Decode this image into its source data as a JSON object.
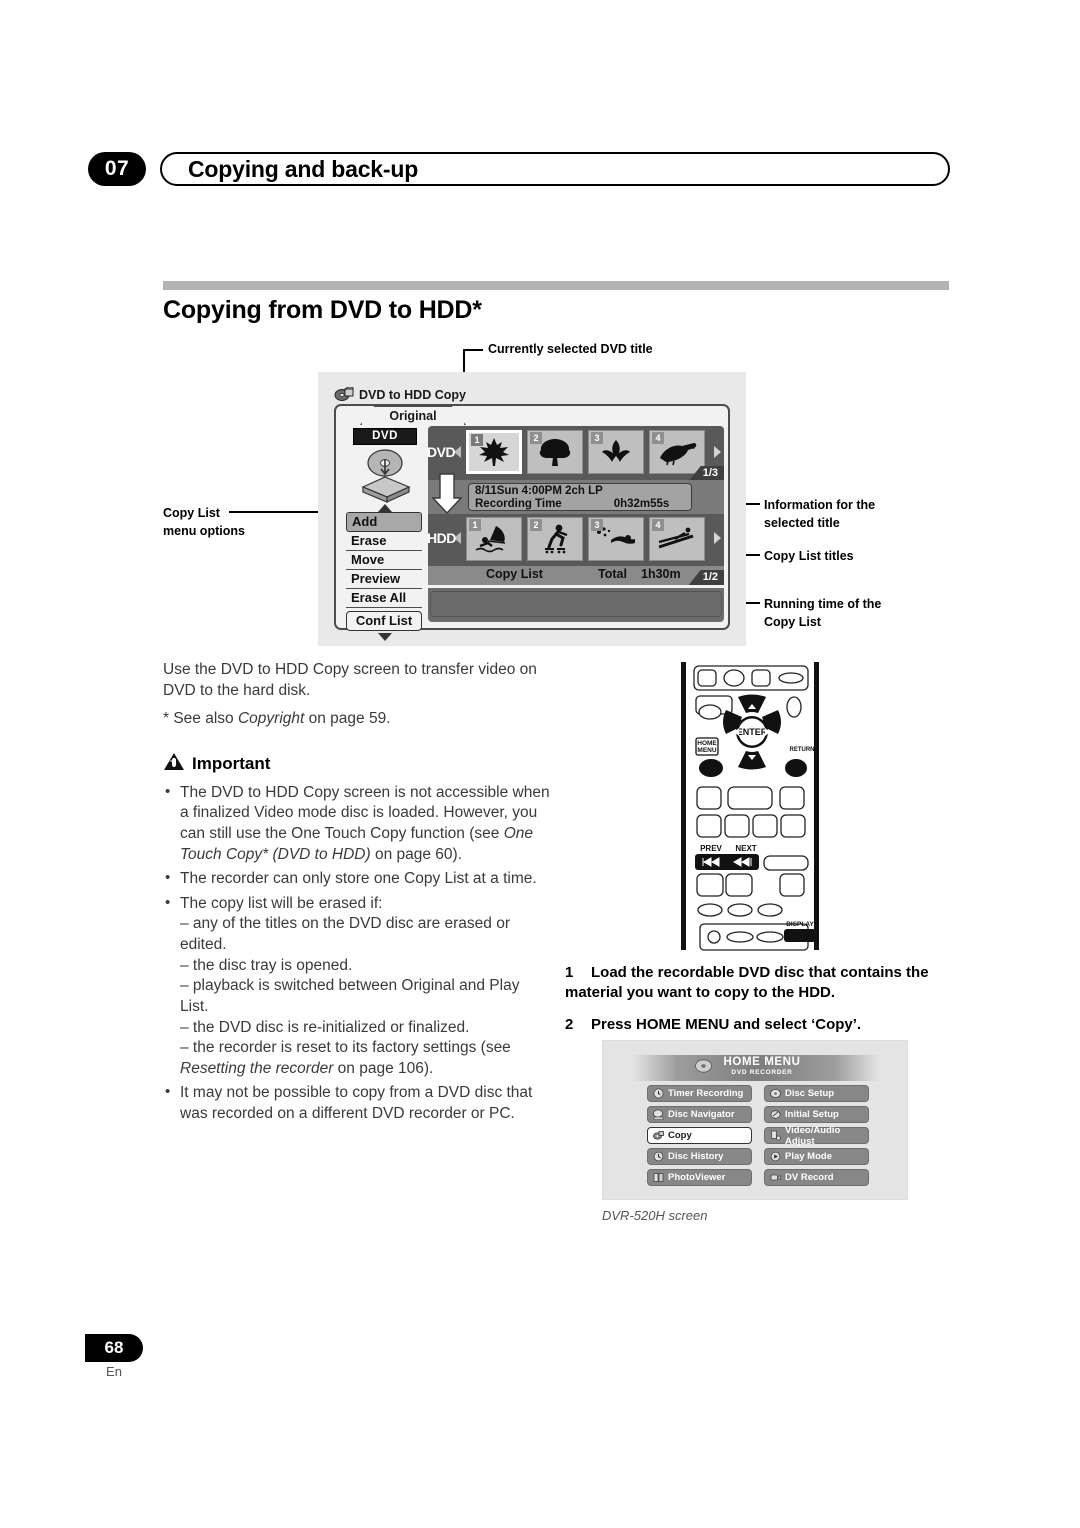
{
  "header": {
    "chapter_number": "07",
    "chapter_title": "Copying and back-up"
  },
  "section": {
    "title": "Copying from DVD to HDD*"
  },
  "figure": {
    "callouts": {
      "top": "Currently selected DVD title",
      "left_line1": "Copy List",
      "left_line2": "menu options",
      "right_1_line1": "Information for the",
      "right_1_line2": "selected title",
      "right_2": "Copy List titles",
      "right_3_line1": "Running time of the",
      "right_3_line2": "Copy List"
    },
    "screen": {
      "title": "DVD to HDD Copy",
      "tab": "Original",
      "source_badge": "DVD",
      "menu_options": [
        "Add",
        "Erase",
        "Move",
        "Preview",
        "Erase All"
      ],
      "selected_option": "Add",
      "conf_list_button": "Conf List",
      "dvd_row": {
        "label": "DVD",
        "thumbnails": [
          "1",
          "2",
          "3",
          "4"
        ],
        "selected": "1",
        "page": "1/3"
      },
      "info": {
        "line1": "8/11Sun  4:00PM   2ch  LP",
        "label": "Recording Time",
        "value": "0h32m55s"
      },
      "hdd_row": {
        "label": "HDD",
        "thumbnails": [
          "1",
          "2",
          "3",
          "4"
        ],
        "page": "1/2"
      },
      "copy_list_bar": {
        "label": "Copy List",
        "total_label": "Total",
        "total_value": "1h30m"
      }
    }
  },
  "body": {
    "intro": "Use the DVD to HDD Copy screen to transfer video on DVD to the hard disk.",
    "footnote_pre": "* See also ",
    "footnote_em": "Copyright",
    "footnote_post": " on page 59.",
    "important_label": "Important",
    "bullets": [
      {
        "pre": "The DVD to HDD Copy screen is not accessible when a finalized Video mode disc is loaded. However, you can still use the One Touch Copy function (see ",
        "em": "One Touch Copy* (DVD to HDD)",
        "post": " on page 60)."
      },
      {
        "pre": "The recorder can only store one Copy List at a time.",
        "em": "",
        "post": ""
      },
      {
        "pre": "The copy list will be erased if:",
        "dashes": [
          "– any of the titles on the DVD disc are erased or edited.",
          "– the disc tray is opened.",
          "– playback is switched between Original and Play List.",
          "– the DVD disc is re-initialized or finalized."
        ],
        "last_dash_pre": "– the recorder is reset to its factory settings (see ",
        "last_dash_em": "Resetting the recorder",
        "last_dash_post": " on page 106)."
      },
      {
        "pre": "It may not be possible to copy from a DVD disc that was recorded on a different DVD recorder or PC.",
        "em": "",
        "post": ""
      }
    ]
  },
  "steps": [
    {
      "num": "1",
      "text": "Load the recordable DVD disc that contains the material you want to copy to the HDD."
    },
    {
      "num": "2",
      "text": "Press HOME MENU and select ‘Copy’."
    }
  ],
  "remote": {
    "enter_label": "ENTER",
    "home_menu_label_1": "HOME",
    "home_menu_label_2": "MENU",
    "return_label": "RETURN",
    "prev_label": "PREV",
    "next_label": "NEXT",
    "display_label": "DISPLAY"
  },
  "home_menu": {
    "title": "HOME MENU",
    "subtitle": "DVD RECORDER",
    "items_left": [
      "Timer Recording",
      "Disc Navigator",
      "Copy",
      "Disc History",
      "PhotoViewer"
    ],
    "items_right": [
      "Disc Setup",
      "Initial Setup",
      "Video/Audio Adjust",
      "Play Mode",
      "DV Record"
    ],
    "selected": "Copy",
    "caption": "DVR-520H screen"
  },
  "footer": {
    "page_number": "68",
    "language": "En"
  },
  "colors": {
    "rule": "#b3b3b3",
    "figure_bg": "#e9e9e9",
    "screen_dark": "#595959",
    "accent_black": "#000000"
  }
}
